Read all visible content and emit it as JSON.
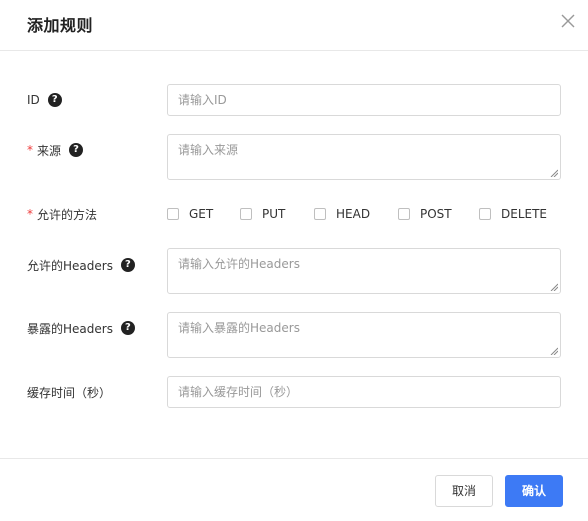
{
  "dialog": {
    "title": "添加规则"
  },
  "form": {
    "id": {
      "label": "ID",
      "placeholder": "请输入ID"
    },
    "source": {
      "required_mark": "*",
      "label": "来源",
      "placeholder": "请输入来源"
    },
    "methods": {
      "required_mark": "*",
      "label": "允许的方法",
      "options": [
        {
          "label": "GET",
          "checked": false
        },
        {
          "label": "PUT",
          "checked": false
        },
        {
          "label": "HEAD",
          "checked": false
        },
        {
          "label": "POST",
          "checked": false
        },
        {
          "label": "DELETE",
          "checked": false
        }
      ]
    },
    "allowed_headers": {
      "label": "允许的Headers",
      "placeholder": "请输入允许的Headers"
    },
    "exposed_headers": {
      "label": "暴露的Headers",
      "placeholder": "请输入暴露的Headers"
    },
    "cache_time": {
      "label": "缓存时间（秒）",
      "placeholder": "请输入缓存时间（秒）"
    }
  },
  "footer": {
    "cancel_label": "取消",
    "ok_label": "确认"
  },
  "colors": {
    "primary": "#3d7af5",
    "required": "#ee3b3b",
    "border": "#d9d9d9"
  }
}
